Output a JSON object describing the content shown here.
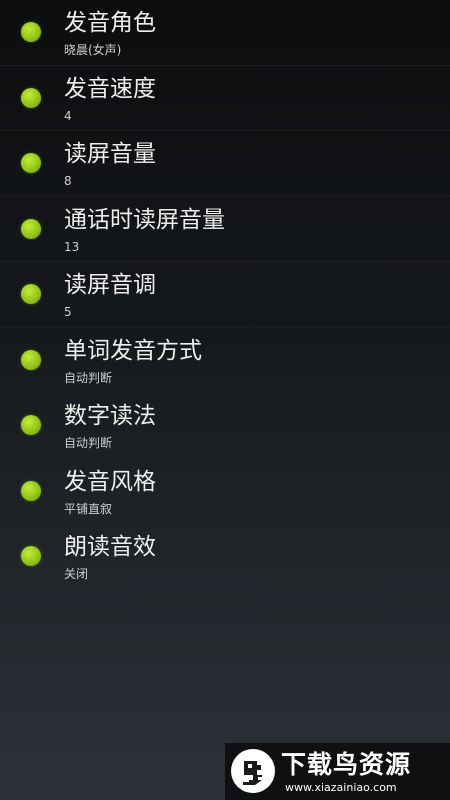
{
  "settings": {
    "items": [
      {
        "title": "发音角色",
        "value": "晓晨(女声)"
      },
      {
        "title": "发音速度",
        "value": "4"
      },
      {
        "title": "读屏音量",
        "value": "8"
      },
      {
        "title": "通话时读屏音量",
        "value": "13"
      },
      {
        "title": "读屏音调",
        "value": "5"
      },
      {
        "title": "单词发音方式",
        "value": "自动判断"
      },
      {
        "title": "数字读法",
        "value": "自动判断"
      },
      {
        "title": "发音风格",
        "value": "平铺直叙"
      },
      {
        "title": "朗读音效",
        "value": "关闭"
      }
    ]
  },
  "watermark": {
    "name": "下载鸟资源",
    "url": "www.xiazainiao.com",
    "logo_icon": "bird-icon"
  },
  "colors": {
    "indicator": "#9acd1e",
    "title_text": "#eeeeee",
    "value_text": "#cfcfcf"
  }
}
